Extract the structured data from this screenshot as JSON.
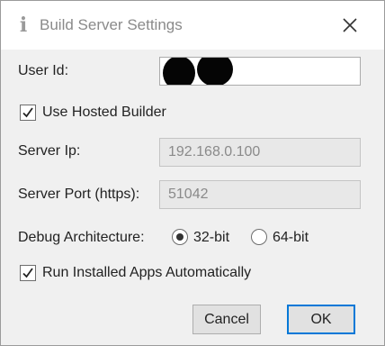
{
  "window": {
    "title": "Build Server Settings",
    "title_icon_glyph": "i"
  },
  "fields": {
    "user_id": {
      "label": "User Id:",
      "value": ""
    },
    "use_hosted_builder": {
      "label": "Use Hosted Builder",
      "checked": true
    },
    "server_ip": {
      "label": "Server Ip:",
      "value": "192.168.0.100"
    },
    "server_port": {
      "label": "Server Port (https):",
      "value": "51042"
    },
    "debug_architecture": {
      "label": "Debug Architecture:",
      "options": [
        {
          "label": "32-bit",
          "selected": true
        },
        {
          "label": "64-bit",
          "selected": false
        }
      ]
    },
    "run_apps": {
      "label": "Run Installed Apps Automatically",
      "checked": true
    }
  },
  "buttons": {
    "cancel": "Cancel",
    "ok": "OK"
  },
  "colors": {
    "accent": "#0078d7",
    "dialog_bg": "#f0f0f0",
    "disabled_field_bg": "#e8e8e8"
  }
}
